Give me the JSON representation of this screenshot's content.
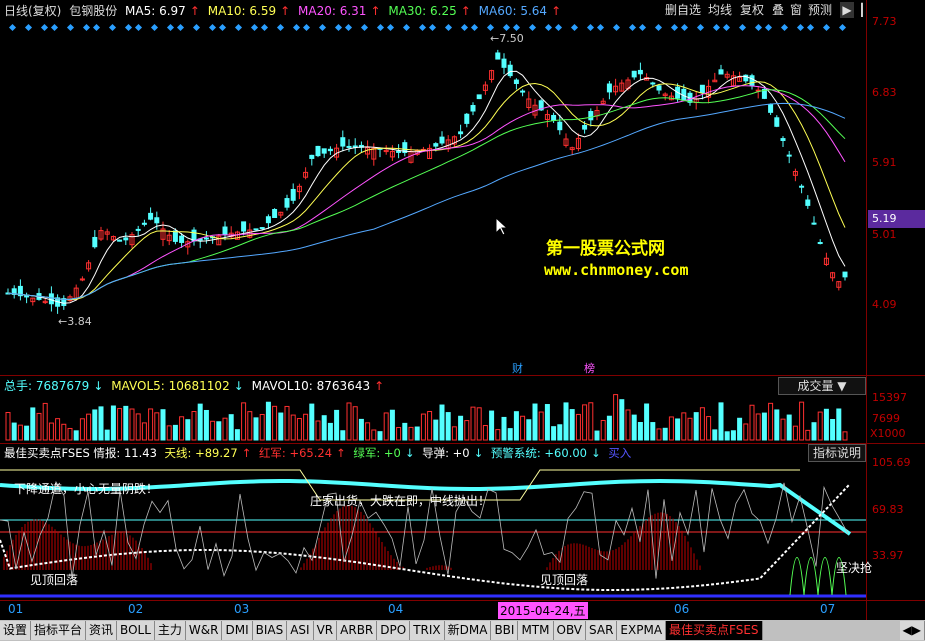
{
  "main_header": {
    "period": "日线(复权)",
    "stock_name": "包钢股份",
    "ma5": "MA5: 6.97",
    "ma10": "MA10: 6.59",
    "ma20": "MA20: 6.31",
    "ma30": "MA30: 6.25",
    "ma60": "MA60: 5.64"
  },
  "toolbar": {
    "delete_watch": "删自选",
    "ma_line": "均线",
    "reinstate": "复权",
    "overlay": "叠",
    "window": "窗",
    "forecast": "预测"
  },
  "price_axis": [
    "7.73",
    "6.83",
    "5.91",
    "5.01",
    "4.09"
  ],
  "current_price": "5.19",
  "annotations": {
    "high": "7.50",
    "low": "3.84",
    "finance_marker": "财",
    "rank_marker": "榜"
  },
  "watermark": {
    "title": "第一股票公式网",
    "url": "www.chnmoney.com"
  },
  "volume_header": {
    "total": "总手: 7687679",
    "mavol5": "MAVOL5: 10681102",
    "mavol10": "MAVOL10: 8763643",
    "dropdown": "成交量"
  },
  "volume_axis": [
    "15397",
    "7699",
    "X1000"
  ],
  "indicator_header": {
    "name": "最佳买卖点FSES 情报: 11.43",
    "tianxian": "天线: +89.27",
    "hongjun": "红军: +65.24",
    "lvjun": "绿军: +0",
    "daodan": "导弹: +0",
    "alarm": "预警系统: +60.00",
    "buy": "买入",
    "help_button": "指标说明"
  },
  "indicator_axis": [
    "105.69",
    "69.83",
    "33.97"
  ],
  "indicator_text": {
    "downtrend": "下降通道，小心无量阴跌！",
    "dealer_out": "庄家出货，大跌在即，中线抛出！",
    "top_fall_1": "见顶回落",
    "top_fall_2": "见顶回落",
    "decisive_buy": "坚决抢"
  },
  "x_axis": [
    "01",
    "02",
    "03",
    "04",
    "2015-04-24,五",
    "06",
    "07"
  ],
  "bottom_tabs": [
    "设置",
    "指标平台",
    "资讯",
    "BOLL",
    "主力",
    "W&R",
    "DMI",
    "BIAS",
    "ASI",
    "VR",
    "ARBR",
    "DPO",
    "TRIX",
    "新DMA",
    "BBI",
    "MTM",
    "OBV",
    "SAR",
    "EXPMA",
    "最佳买卖点FSES"
  ],
  "colors": {
    "up_candle": "#ff3030",
    "down_candle": "#54ffff",
    "ma5": "#ffffff",
    "ma10": "#ffff54",
    "ma20": "#ff54ff",
    "ma30": "#54ff54",
    "ma60": "#54a8ff",
    "watermark_title": "#ffff00"
  }
}
